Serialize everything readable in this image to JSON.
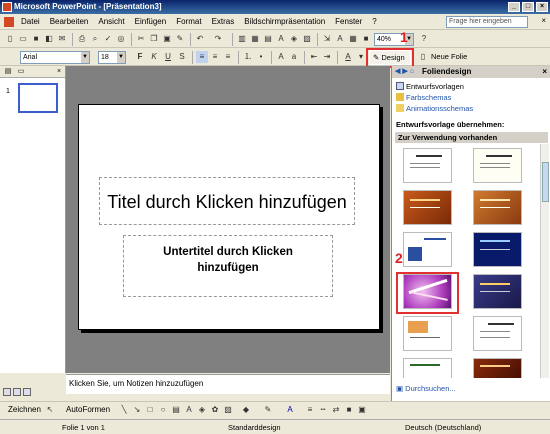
{
  "window": {
    "title": "Microsoft PowerPoint - [Präsentation3]"
  },
  "menu": {
    "items": [
      "Datei",
      "Bearbeiten",
      "Ansicht",
      "Einfügen",
      "Format",
      "Extras",
      "Bildschirmpräsentation",
      "Fenster",
      "?"
    ],
    "help_placeholder": "Frage hier eingeben"
  },
  "toolbar": {
    "zoom": "40%",
    "font": "Arial",
    "font_size": "18",
    "bold": "F",
    "italic": "K",
    "underline": "U",
    "shadow": "S",
    "design_label": "Design",
    "new_slide_label": "Neue Folie"
  },
  "annotations": {
    "badge1": "1",
    "badge2": "2"
  },
  "slide_panel": {
    "thumb_number": "1"
  },
  "slide": {
    "title_placeholder": "Titel durch Klicken hinzufügen",
    "subtitle_line1": "Untertitel durch Klicken",
    "subtitle_line2": "hinzufügen"
  },
  "notes": {
    "placeholder": "Klicken Sie, um Notizen hinzuzufügen"
  },
  "drawing": {
    "draw_label": "Zeichnen",
    "autoshapes_label": "AutoFormen"
  },
  "status": {
    "slide": "Folie 1 von 1",
    "design": "Standarddesign",
    "language": "Deutsch (Deutschland)"
  },
  "taskpane": {
    "title": "Foliendesign",
    "links": [
      "Entwurfsvorlagen",
      "Farbschemas",
      "Animationsschemas"
    ],
    "apply_label": "Entwurfsvorlage übernehmen:",
    "section_label": "Zur Verwendung vorhanden",
    "browse_label": "Durchsuchen..."
  },
  "colors": {
    "accent": "#0a246a",
    "highlight": "#e03030"
  }
}
